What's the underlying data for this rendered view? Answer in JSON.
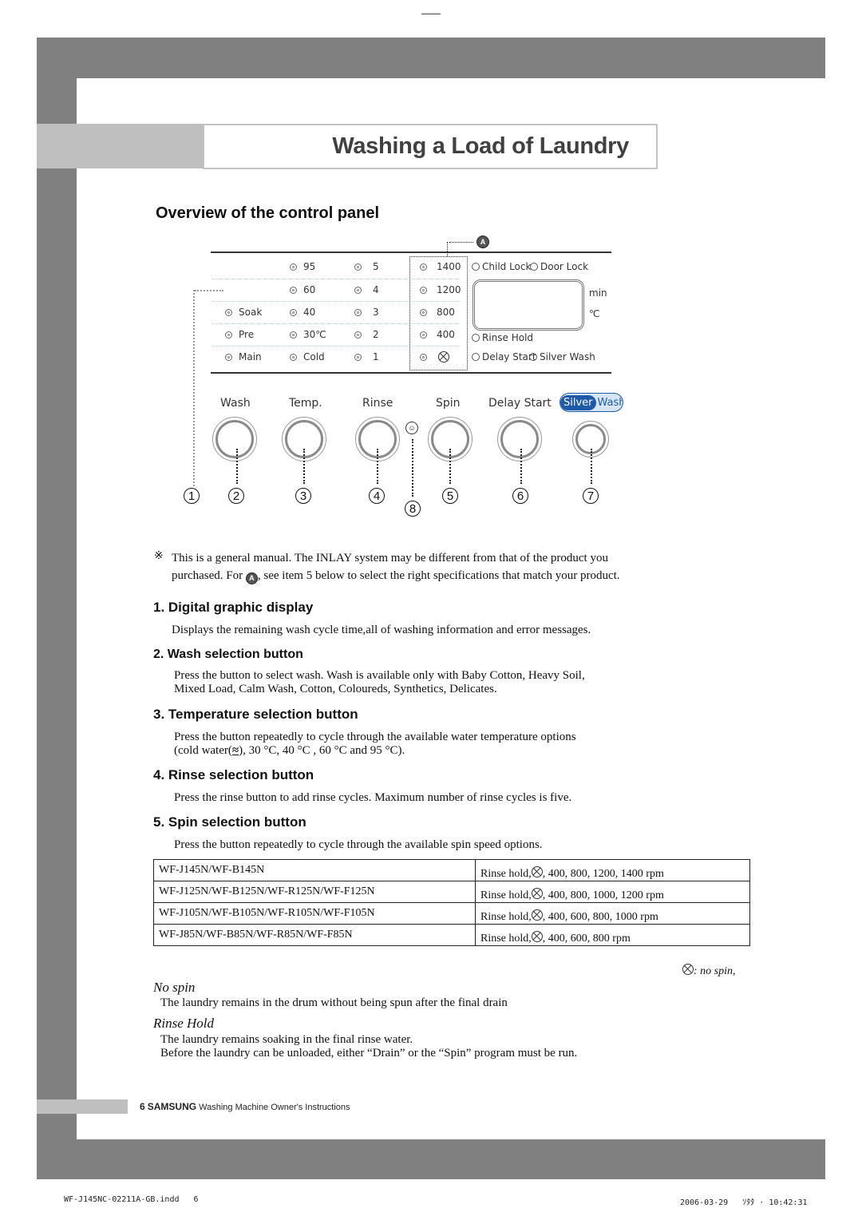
{
  "page": {
    "title": "Washing a Load of Laundry",
    "section_title": "Overview of the control panel"
  },
  "control_panel": {
    "wash_column": [
      "Soak",
      "Pre",
      "Main"
    ],
    "temp_column": [
      "95",
      "60",
      "40",
      "30℃",
      "Cold"
    ],
    "rinse_column": [
      "5",
      "4",
      "3",
      "2",
      "1"
    ],
    "spin_column": [
      "1400",
      "1200",
      "800",
      "400",
      "no-spin-icon"
    ],
    "status_indicators": {
      "child_lock": "Child Lock",
      "door_lock": "Door Lock",
      "rinse_hold": "Rinse Hold",
      "delay_start": "Delay Start",
      "silver_wash": "Silver Wash"
    },
    "display_units": {
      "min": "min",
      "celsius": "℃"
    },
    "callout_a": "A",
    "buttons": [
      {
        "label": "Wash",
        "number": "2"
      },
      {
        "label": "Temp.",
        "number": "3"
      },
      {
        "label": "Rinse",
        "number": "4"
      },
      {
        "label": "Spin",
        "number": "5"
      },
      {
        "label": "Delay Start",
        "number": "6"
      },
      {
        "label_part1": "Silver",
        "label_part2": "Wash",
        "number": "7"
      }
    ],
    "display_number": "1",
    "child_lock_number": "8"
  },
  "note": {
    "symbol": "※",
    "line1": "This is a general manual. The INLAY system may be different from that of the product you",
    "line2_before": "purchased. For",
    "line2_badge": "A",
    "line2_after": ", see item 5 below to select the right specifications that match your product."
  },
  "sections": [
    {
      "heading": "1. Digital graphic display",
      "text": "Displays the remaining wash cycle time,all of washing information and error messages."
    },
    {
      "heading": "2. Wash selection button",
      "text1": "Press the button to select wash. Wash is available only with Baby Cotton, Heavy Soil,",
      "text2": "Mixed Load, Calm Wash, Cotton, Coloureds, Synthetics, Delicates."
    },
    {
      "heading": "3. Temperature selection button",
      "text1": "Press the button  repeatedly to cycle through the available water temperature options",
      "text2_before": "(cold water(",
      "text2_icon": "cold-water-icon",
      "text2_after": "), 30 °C, 40 °C , 60 °C and 95 °C)."
    },
    {
      "heading": "4. Rinse selection button",
      "text": "Press the rinse button to add rinse cycles. Maximum number of rinse cycles is five."
    },
    {
      "heading": "5. Spin selection button",
      "text": "Press the button repeatedly to cycle through the available spin speed options."
    }
  ],
  "spin_table": [
    {
      "models": "WF-J145N/WF-B145N",
      "prefix": "Rinse hold,",
      "speeds": ", 400, 800, 1200, 1400 rpm"
    },
    {
      "models": "WF-J125N/WF-B125N/WF-R125N/WF-F125N",
      "prefix": "Rinse hold,",
      "speeds": ", 400, 800, 1000, 1200 rpm"
    },
    {
      "models": "WF-J105N/WF-B105N/WF-R105N/WF-F105N",
      "prefix": "Rinse hold,",
      "speeds": ", 400, 600, 800, 1000 rpm"
    },
    {
      "models": "WF-J85N/WF-B85N/WF-R85N/WF-F85N",
      "prefix": "Rinse hold,",
      "speeds": ", 400, 600, 800 rpm"
    }
  ],
  "legend": {
    "text": ": no spin,"
  },
  "no_spin": {
    "heading": "No spin",
    "text": "The laundry remains in the drum without being spun after the final drain"
  },
  "rinse_hold": {
    "heading": "Rinse Hold",
    "text1": "The laundry remains soaking in the final rinse water.",
    "text2": "Before the laundry can be unloaded, either “Drain” or the “Spin” program must be run."
  },
  "footer": {
    "page_number": "6",
    "brand": "SAMSUNG",
    "text": "Washing Machine Owner's Instructions"
  },
  "print_meta": {
    "file": "WF-J145NC-02211A-GB.indd   6",
    "timestamp": "2006-03-29   ｿﾀﾀ · 10:42:31"
  }
}
